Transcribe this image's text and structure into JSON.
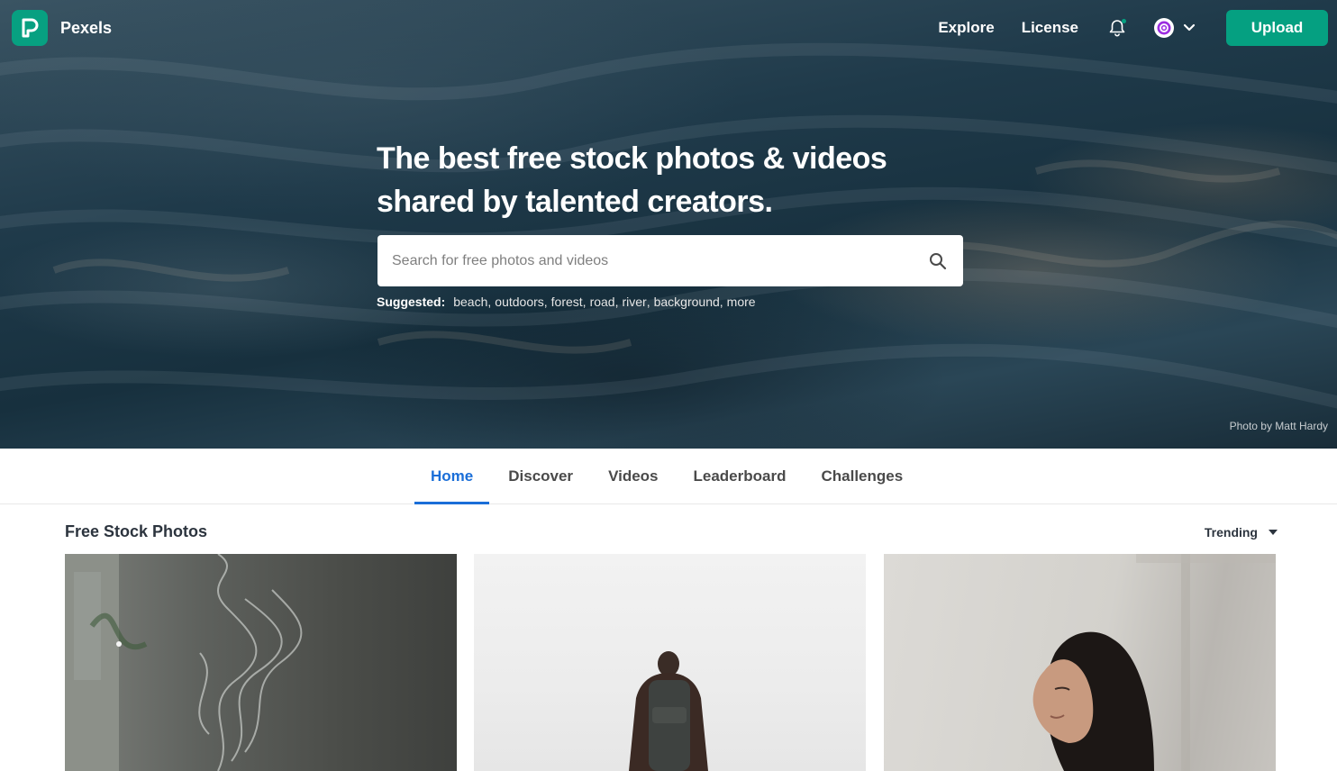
{
  "brand": {
    "name": "Pexels",
    "color": "#05a081"
  },
  "header": {
    "nav": [
      {
        "label": "Explore"
      },
      {
        "label": "License"
      }
    ],
    "upload_label": "Upload"
  },
  "hero": {
    "headline_line1": "The best free stock photos & videos",
    "headline_line2": "shared by talented creators.",
    "search_placeholder": "Search for free photos and videos",
    "suggested_label": "Suggested:",
    "suggestions": [
      "beach",
      "outdoors",
      "forest",
      "road",
      "river",
      "background",
      "more"
    ],
    "credit": "Photo by Matt Hardy"
  },
  "tabs": [
    {
      "label": "Home",
      "active": true
    },
    {
      "label": "Discover",
      "active": false
    },
    {
      "label": "Videos",
      "active": false
    },
    {
      "label": "Leaderboard",
      "active": false
    },
    {
      "label": "Challenges",
      "active": false
    }
  ],
  "section": {
    "title": "Free Stock Photos",
    "sort_label": "Trending"
  },
  "accent": {
    "tab_active": "#1a6ed8"
  }
}
